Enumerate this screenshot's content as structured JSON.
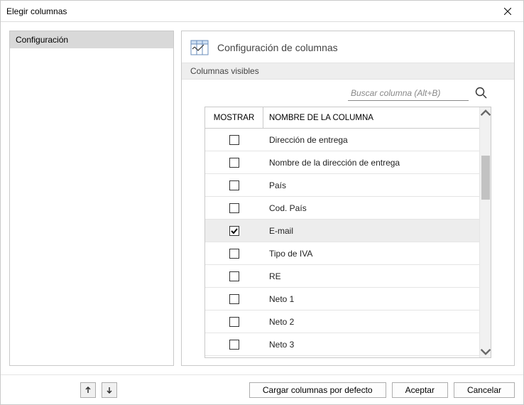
{
  "window": {
    "title": "Elegir columnas"
  },
  "sidebar": {
    "items": [
      "Configuración"
    ]
  },
  "main": {
    "title": "Configuración de columnas",
    "section": "Columnas visibles",
    "search_placeholder": "Buscar columna (Alt+B)"
  },
  "table": {
    "headers": {
      "show": "MOSTRAR",
      "name": "NOMBRE DE LA COLUMNA"
    },
    "rows": [
      {
        "checked": false,
        "name": "Dirección de entrega",
        "selected": false
      },
      {
        "checked": false,
        "name": "Nombre de la dirección de entrega",
        "selected": false
      },
      {
        "checked": false,
        "name": "País",
        "selected": false
      },
      {
        "checked": false,
        "name": "Cod. País",
        "selected": false
      },
      {
        "checked": true,
        "name": "E-mail",
        "selected": true
      },
      {
        "checked": false,
        "name": "Tipo de IVA",
        "selected": false
      },
      {
        "checked": false,
        "name": "RE",
        "selected": false
      },
      {
        "checked": false,
        "name": "Neto 1",
        "selected": false
      },
      {
        "checked": false,
        "name": "Neto 2",
        "selected": false
      },
      {
        "checked": false,
        "name": "Neto 3",
        "selected": false
      }
    ]
  },
  "footer": {
    "load_defaults": "Cargar columnas por defecto",
    "accept": "Aceptar",
    "cancel": "Cancelar"
  }
}
